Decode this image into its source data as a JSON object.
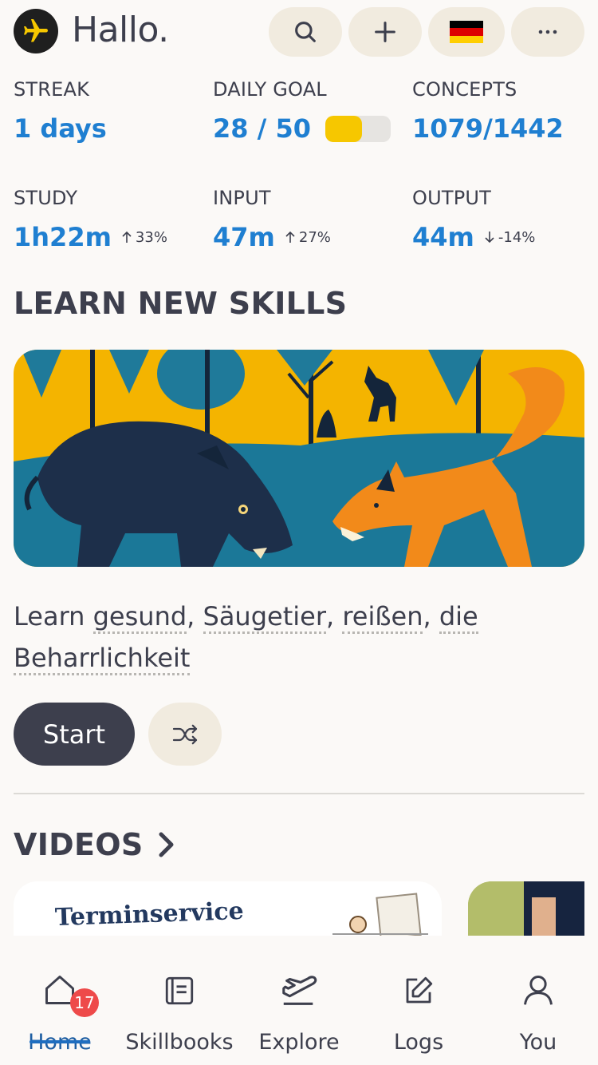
{
  "header": {
    "greeting": "Hallo.",
    "icons": {
      "logo": "airplane-icon",
      "search": "search-icon",
      "add": "plus-icon",
      "language": "german-flag-icon",
      "more": "more-horizontal-icon"
    }
  },
  "stats": {
    "streak": {
      "label": "STREAK",
      "value": "1 days"
    },
    "daily_goal": {
      "label": "DAILY GOAL",
      "value": "28 / 50",
      "progress": 0.56
    },
    "concepts": {
      "label": "CONCEPTS",
      "value": "1079/1442"
    },
    "study": {
      "label": "STUDY",
      "value": "1h22m",
      "delta": "33%",
      "direction": "up"
    },
    "input": {
      "label": "INPUT",
      "value": "47m",
      "delta": "27%",
      "direction": "up"
    },
    "output": {
      "label": "OUTPUT",
      "value": "44m",
      "delta": "-14%",
      "direction": "down"
    }
  },
  "learn": {
    "title": "LEARN NEW SKILLS",
    "prefix": "Learn",
    "words": [
      "gesund",
      "Säugetier",
      "reißen",
      "die Beharrlichkeit"
    ],
    "start_label": "Start",
    "shuffle_icon": "shuffle-icon"
  },
  "videos": {
    "title": "VIDEOS",
    "cards": [
      {
        "title": "Terminservice"
      }
    ]
  },
  "tabbar": {
    "items": [
      {
        "label": "Home",
        "icon": "home-icon",
        "badge": "17",
        "active": true
      },
      {
        "label": "Skillbooks",
        "icon": "book-icon"
      },
      {
        "label": "Explore",
        "icon": "plane-icon"
      },
      {
        "label": "Logs",
        "icon": "edit-icon"
      },
      {
        "label": "You",
        "icon": "user-icon"
      }
    ]
  },
  "colors": {
    "accent": "#1f7fd1",
    "text": "#3d3f4d",
    "chip": "#f1ebdf",
    "goal_fill": "#f6c700",
    "badge": "#ee4a4a"
  }
}
